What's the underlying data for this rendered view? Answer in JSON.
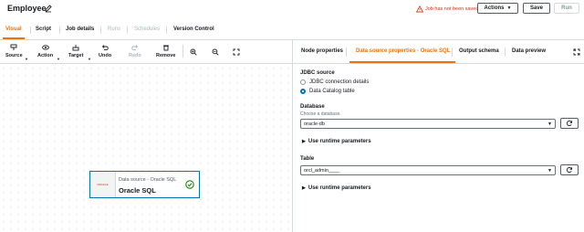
{
  "header": {
    "title": "Employee",
    "warning": "Job has not been saved",
    "actions_label": "Actions",
    "save_label": "Save",
    "run_label": "Run"
  },
  "tabs": [
    {
      "label": "Visual"
    },
    {
      "label": "Script"
    },
    {
      "label": "Job details"
    },
    {
      "label": "Runs"
    },
    {
      "label": "Schedules"
    },
    {
      "label": "Version Control"
    }
  ],
  "toolbar": {
    "source": "Source",
    "action": "Action",
    "target": "Target",
    "undo": "Undo",
    "redo": "Redo",
    "remove": "Remove"
  },
  "node": {
    "subtitle": "Data source - Oracle SQL",
    "title": "Oracle SQL",
    "thumb_text": "ORACLE"
  },
  "panel": {
    "tabs": [
      {
        "label": "Node properties"
      },
      {
        "label": "Data source properties - Oracle SQL"
      },
      {
        "label": "Output schema"
      },
      {
        "label": "Data preview"
      }
    ],
    "jdbc_label": "JDBC source",
    "radio_jdbc": "JDBC connection details",
    "radio_catalog": "Data Catalog table",
    "database_label": "Database",
    "database_hint": "Choose a database.",
    "database_value": "oracle-db",
    "runtime_params_1": "Use runtime parameters",
    "table_label": "Table",
    "table_value": "orcl_admin____",
    "runtime_params_2": "Use runtime parameters"
  },
  "colors": {
    "accent": "#ec7211",
    "link": "#0073bb",
    "warning": "#d13212",
    "success": "#1d8102"
  }
}
